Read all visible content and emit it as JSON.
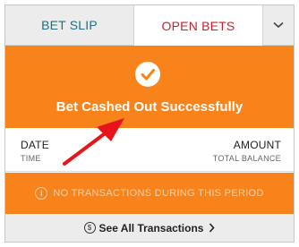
{
  "tabs": [
    {
      "label": "BET SLIP",
      "active": false
    },
    {
      "label": "OPEN BETS",
      "active": true
    }
  ],
  "more_icon": "chevron-down-icon",
  "success": {
    "icon": "checkmark-circle-icon",
    "message": "Bet Cashed Out Successfully"
  },
  "table_header": {
    "left_main": "DATE",
    "left_sub": "TIME",
    "right_main": "AMOUNT",
    "right_sub": "TOTAL BALANCE"
  },
  "empty_state": {
    "icon": "info-icon",
    "text": "NO TRANSACTIONS DURING THIS PERIOD"
  },
  "footer": {
    "icon": "dollar-circle-icon",
    "label": "See All Transactions"
  },
  "colors": {
    "accent_orange": "#f9831b",
    "tab_teal": "#1f6f82",
    "tab_red": "#c8212a",
    "annotation_arrow": "#e8141c"
  }
}
